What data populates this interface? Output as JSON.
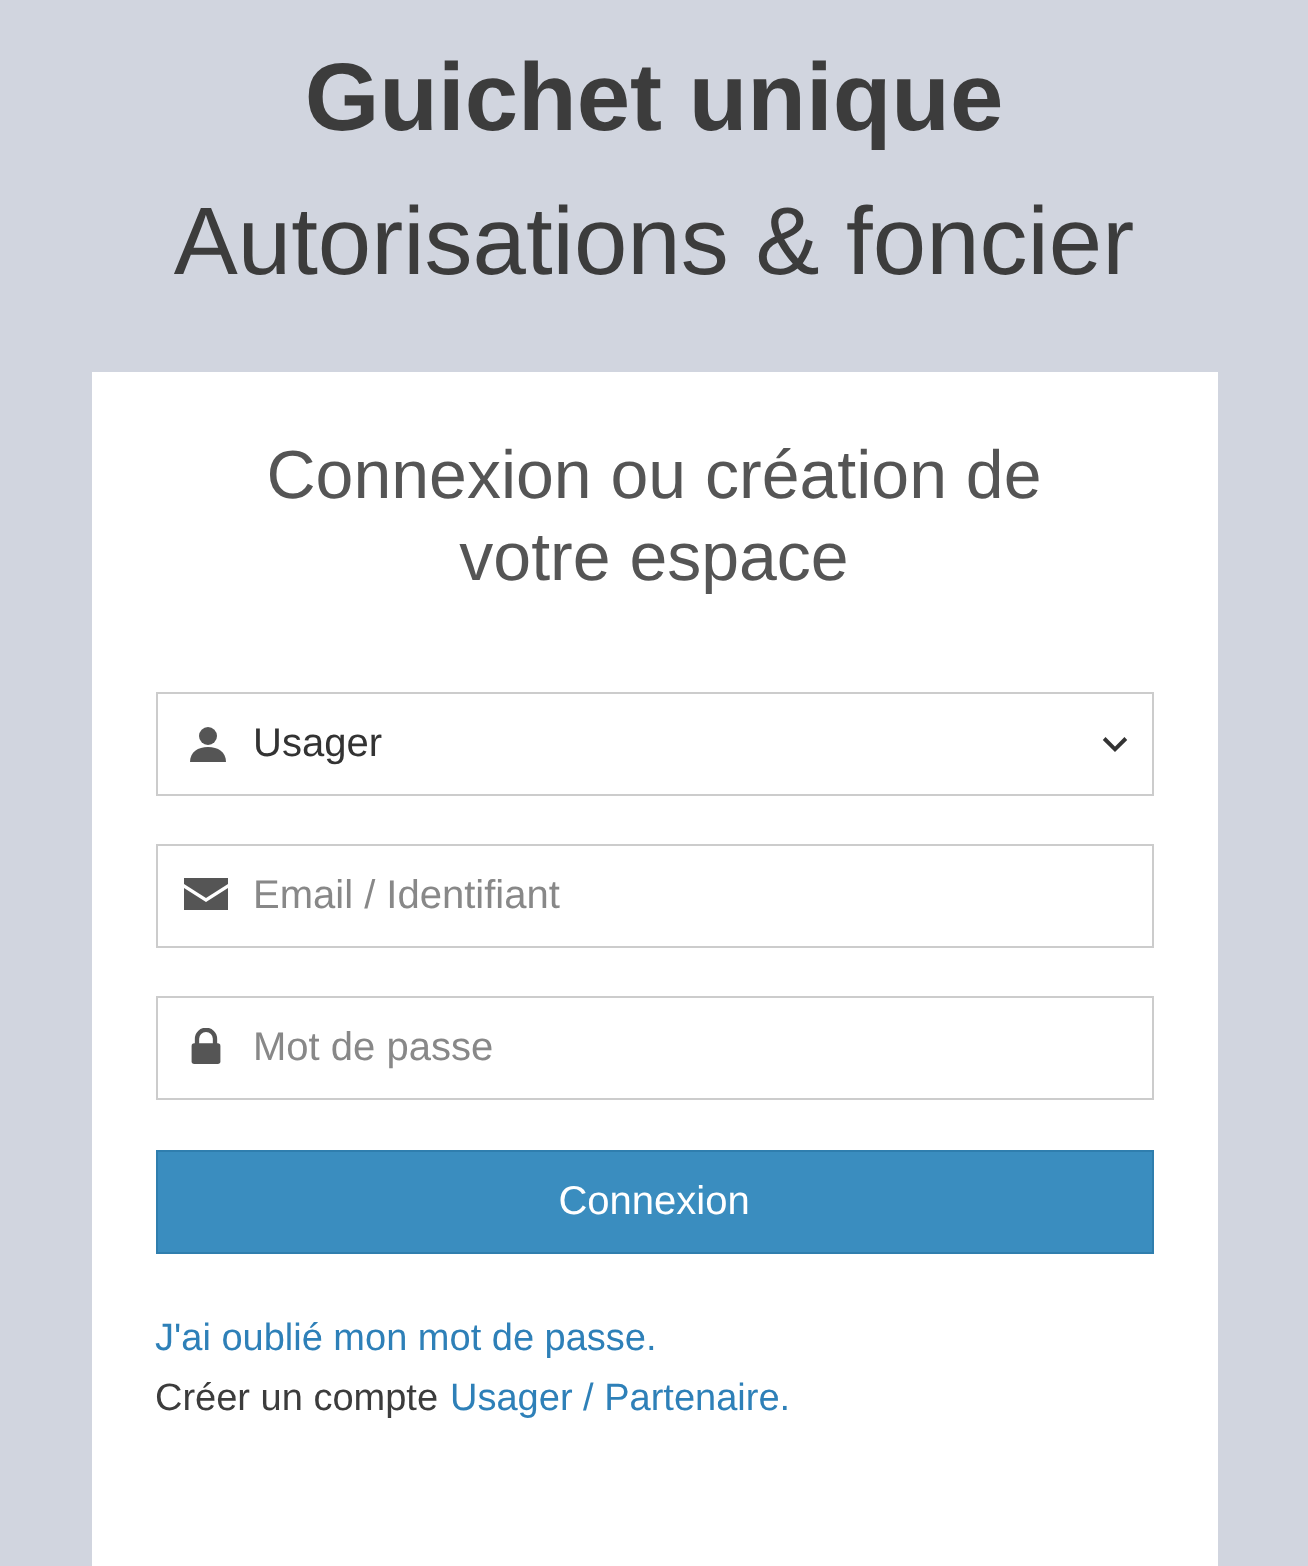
{
  "header": {
    "title": "Guichet unique",
    "subtitle": "Autorisations & foncier"
  },
  "card": {
    "heading": "Connexion ou création de votre espace",
    "account_type": {
      "value": "Usager"
    },
    "email": {
      "placeholder": "Email / Identifiant"
    },
    "password": {
      "placeholder": "Mot de passe"
    },
    "submit": "Connexion",
    "forgot_link": "J'ai oublié mon mot de passe.",
    "create_text": "Créer un compte",
    "create_link": "Usager / Partenaire."
  }
}
